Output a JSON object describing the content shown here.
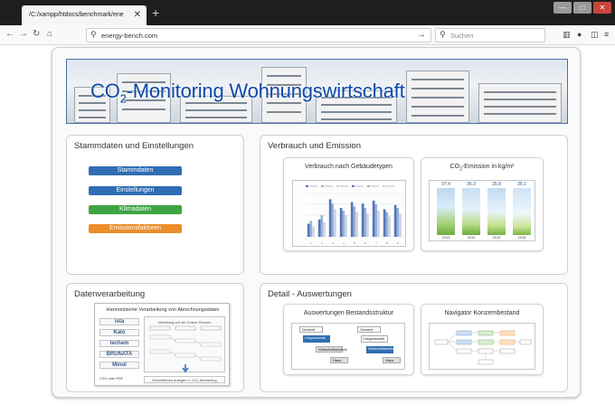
{
  "browser": {
    "tab_title": "/C:/xampp/htdocs/benchmark/ene",
    "tab_close": "✕",
    "new_tab": "+",
    "url": "energy-bench.com",
    "search_placeholder": "Suchen",
    "window_controls": [
      "—",
      "□",
      "✕"
    ],
    "toolbar_icons": [
      "library-icon",
      "account-icon",
      "sidebar-icon",
      "menu-icon"
    ]
  },
  "banner": {
    "title_prefix": "CO",
    "title_sub": "2",
    "title_rest": "-Monitoring Wohnungswirtschaft"
  },
  "panels": {
    "stammdaten": {
      "title": "Stammdaten und Einstellungen",
      "buttons": [
        {
          "label": "Stammdaten",
          "color": "#2f6eb2"
        },
        {
          "label": "Einstellungen",
          "color": "#2f6eb2"
        },
        {
          "label": "Klimadaten",
          "color": "#3ea443"
        },
        {
          "label": "Emissionsfaktoren",
          "color": "#eb8d2a"
        }
      ]
    },
    "verbrauch": {
      "title": "Verbrauch und Emission",
      "card1_title": "Verbrauch nach Gebäudetypen",
      "card2_title_prefix": "CO",
      "card2_title_sub": "2",
      "card2_title_rest": "-Emission in kg/m²"
    },
    "datenverarbeitung": {
      "title": "Datenverarbeitung",
      "doc_title": "Harmonisierte Verarbeitung von Abrechnungsdaten",
      "providers": [
        "ista",
        "Kalo",
        "techem",
        "BRUNATA",
        "Minol"
      ],
      "doc_main_title": "Verteilung auf die Untere Ebenen",
      "doc_left_foot": "CSV oder PDF",
      "doc_footer": "Einheitliches Anlegen d. CO₂-Monitoring"
    },
    "detail": {
      "title": "Detail - Auswertungen",
      "card1_title": "Auswertungen Bestandsstruktur",
      "card1_boxes": [
        "Gesamt",
        "Liegenschaft",
        "Wirtschaftseinheit",
        "Haus"
      ],
      "card2_title": "Navigator Konzernbestand"
    }
  },
  "chart_data": [
    {
      "type": "bar",
      "title": "Verbrauch nach Gebäudetypen",
      "categories": [
        "1",
        "2",
        "3",
        "4",
        "5",
        "6",
        "7",
        "8",
        "9"
      ],
      "series": [
        {
          "values": [
            18,
            24,
            52,
            40,
            48,
            46,
            50,
            38,
            44
          ]
        },
        {
          "values": [
            22,
            30,
            46,
            36,
            42,
            40,
            45,
            34,
            40
          ]
        },
        {
          "values": [
            14,
            20,
            38,
            30,
            34,
            32,
            36,
            28,
            32
          ]
        }
      ],
      "ylim": [
        0,
        60
      ]
    },
    {
      "type": "bar",
      "title": "CO₂-Emission in kg/m²",
      "categories": [
        "2013",
        "2014",
        "2015",
        "2016"
      ],
      "values": [
        37.4,
        36.3,
        35.8,
        35.1
      ],
      "ylim": [
        0,
        40
      ]
    }
  ],
  "colors": {
    "accent_blue": "#2f6eb2",
    "green": "#3ea443",
    "orange": "#eb8d2a",
    "banner_text": "#0d49a8"
  }
}
